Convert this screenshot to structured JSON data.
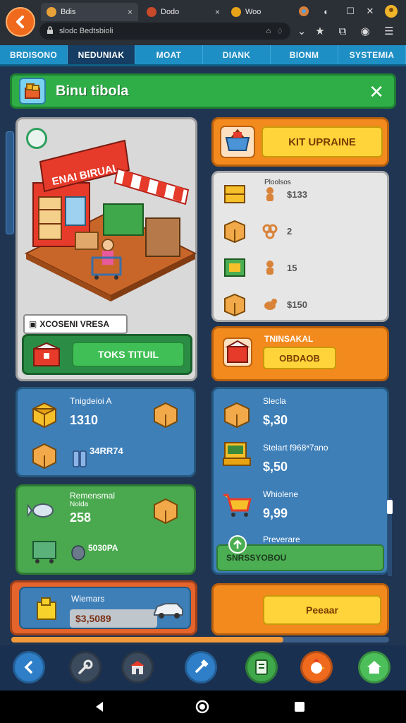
{
  "browser": {
    "tabs": [
      {
        "title": "Bdis",
        "close": "×"
      },
      {
        "title": "Dodo",
        "close": "×"
      },
      {
        "title": "Woo",
        "close": ""
      }
    ],
    "url": "slodc Bedtsbioli",
    "window_controls": [
      "—",
      "☐",
      "✕"
    ]
  },
  "nav": {
    "tabs": [
      "BRDISONO",
      "NEDUNIAK",
      "MOAT",
      "DIANK",
      "BIONM",
      "SYSTEMIA"
    ],
    "active_index": 1
  },
  "banner": {
    "title": "Binu tibola",
    "close": "✕"
  },
  "shop": {
    "sign": "ENAI BIRUAL",
    "label": "XCOSENI VRESA",
    "action_button": "TOKS TITUIL"
  },
  "upgrade": {
    "button": "KIT UPRAINE"
  },
  "list": {
    "header": "Ploolsos",
    "rows": [
      {
        "value": "$133"
      },
      {
        "value": "2"
      },
      {
        "value": "15"
      },
      {
        "value": "$150"
      }
    ]
  },
  "transaction": {
    "title": "TNINSAKAL",
    "button": "OBDAOB"
  },
  "stats_left_top": {
    "title": "Tnigdeioi A",
    "value": "1310",
    "secondary": "34RR74"
  },
  "stats_left_green": {
    "title": "Remensmal",
    "subtitle": "Nolda",
    "value": "258",
    "secondary": "5030PA"
  },
  "stats_right": {
    "items": [
      {
        "label": "Slecla",
        "value": "$,30"
      },
      {
        "label": "Stelart f968ᵃ7ano",
        "value": "$,50"
      },
      {
        "label": "Whiolene",
        "value": "9,99"
      },
      {
        "label": "Preverare",
        "value": ""
      }
    ],
    "footer_button": "SNRSSYOBOU"
  },
  "wallet": {
    "label": "Wiemars",
    "amount": "$3,5089"
  },
  "preview": {
    "button": "Peeaar"
  },
  "progress": {
    "value": 0.72
  },
  "colors": {
    "accent_orange": "#f28a1e",
    "accent_green": "#2fae48",
    "accent_blue": "#3e7fb8",
    "button_yellow": "#ffd43a"
  },
  "toolbar": {
    "icons": [
      "back-arrow-icon",
      "wrench-icon",
      "shop-icon",
      "hammer-icon",
      "notebook-icon",
      "rooster-icon",
      "home-icon"
    ]
  }
}
